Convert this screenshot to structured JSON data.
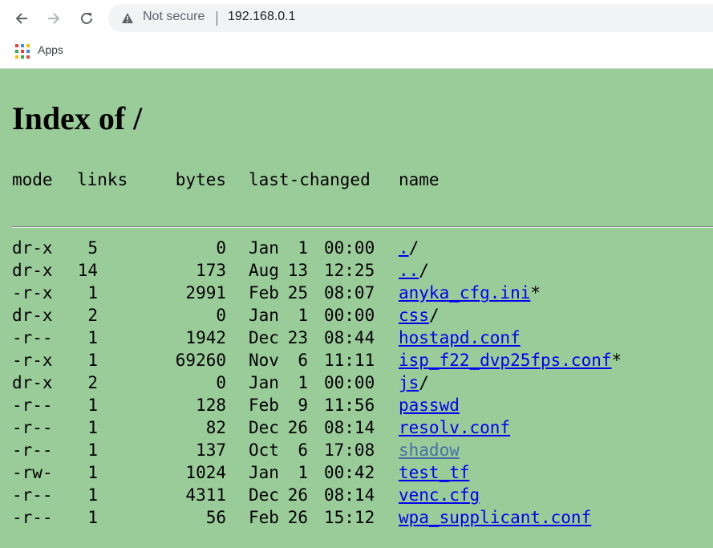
{
  "browser": {
    "security_label": "Not secure",
    "url": "192.168.0.1",
    "bookmarks": [
      {
        "label": "Apps"
      }
    ]
  },
  "page": {
    "title": "Index of /",
    "columns": [
      "mode",
      "links",
      "bytes",
      "last-changed",
      "name"
    ],
    "rows": [
      {
        "mode": "dr-x",
        "links": "5",
        "bytes": "0",
        "month": "Jan",
        "day": "1",
        "time": "00:00",
        "name": ".",
        "suffix": "/"
      },
      {
        "mode": "dr-x",
        "links": "14",
        "bytes": "173",
        "month": "Aug",
        "day": "13",
        "time": "12:25",
        "name": "..",
        "suffix": "/"
      },
      {
        "mode": "-r-x",
        "links": "1",
        "bytes": "2991",
        "month": "Feb",
        "day": "25",
        "time": "08:07",
        "name": "anyka_cfg.ini",
        "suffix": "*"
      },
      {
        "mode": "dr-x",
        "links": "2",
        "bytes": "0",
        "month": "Jan",
        "day": "1",
        "time": "00:00",
        "name": "css",
        "suffix": "/"
      },
      {
        "mode": "-r--",
        "links": "1",
        "bytes": "1942",
        "month": "Dec",
        "day": "23",
        "time": "08:44",
        "name": "hostapd.conf",
        "suffix": ""
      },
      {
        "mode": "-r-x",
        "links": "1",
        "bytes": "69260",
        "month": "Nov",
        "day": "6",
        "time": "11:11",
        "name": "isp_f22_dvp25fps.conf",
        "suffix": "*"
      },
      {
        "mode": "dr-x",
        "links": "2",
        "bytes": "0",
        "month": "Jan",
        "day": "1",
        "time": "00:00",
        "name": "js",
        "suffix": "/"
      },
      {
        "mode": "-r--",
        "links": "1",
        "bytes": "128",
        "month": "Feb",
        "day": "9",
        "time": "11:56",
        "name": "passwd",
        "suffix": ""
      },
      {
        "mode": "-r--",
        "links": "1",
        "bytes": "82",
        "month": "Dec",
        "day": "26",
        "time": "08:14",
        "name": "resolv.conf",
        "suffix": ""
      },
      {
        "mode": "-r--",
        "links": "1",
        "bytes": "137",
        "month": "Oct",
        "day": "6",
        "time": "17:08",
        "name": "shadow",
        "suffix": ""
      },
      {
        "mode": "-rw-",
        "links": "1",
        "bytes": "1024",
        "month": "Jan",
        "day": "1",
        "time": "00:42",
        "name": "test_tf",
        "suffix": ""
      },
      {
        "mode": "-r--",
        "links": "1",
        "bytes": "4311",
        "month": "Dec",
        "day": "26",
        "time": "08:14",
        "name": "venc.cfg",
        "suffix": ""
      },
      {
        "mode": "-r--",
        "links": "1",
        "bytes": "56",
        "month": "Feb",
        "day": "26",
        "time": "15:12",
        "name": "wpa_supplicant.conf",
        "suffix": ""
      }
    ]
  },
  "colors": {
    "page_background": "#99cc99",
    "link": "#0000ee",
    "visited_link": "#4a6fa5"
  },
  "icons": [
    "back-arrow-icon",
    "forward-arrow-icon",
    "reload-icon",
    "warning-icon",
    "apps-grid-icon"
  ]
}
